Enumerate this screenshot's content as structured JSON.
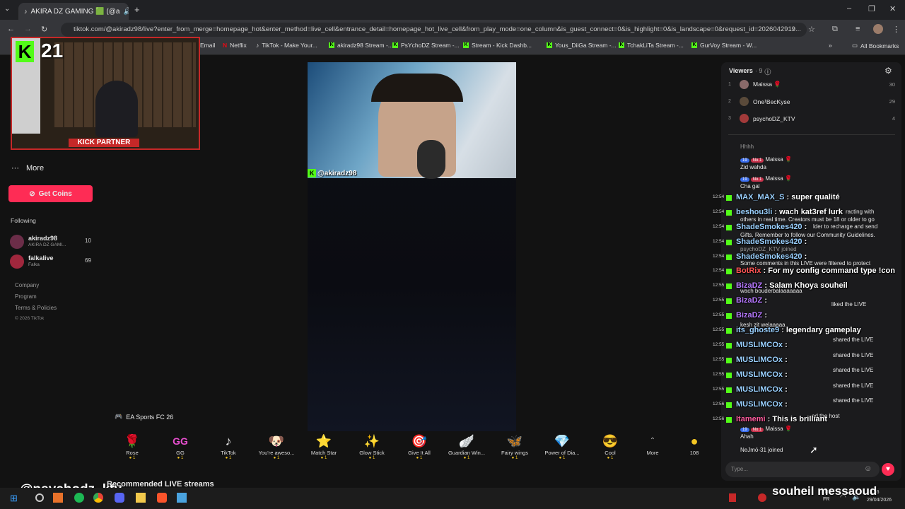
{
  "browser": {
    "tab_title": "AKIRA DZ GAMING 🟩 (@a",
    "url": "tiktok.com/@akiradz98/live?enter_from_merge=homepage_hot&enter_method=live_cell&entrance_detail=homepage_hot_live_cell&from_play_mode=one_column&is_guest_connect=0&is_highlight=0&is_landscape=0&request_id=2026042919...",
    "bookmarks": [
      "Email",
      "Netflix",
      "TikTok - Make Your...",
      "akiradz98 Stream -...",
      "PsYchoDZ Stream -...",
      "Stream - Kick Dashb...",
      "Yous_DiiGa Stream -...",
      "TchakLiTa Stream -...",
      "GurVoy Stream - W..."
    ],
    "all_bookmarks": "All Bookmarks"
  },
  "overlay": {
    "badge_number": "21",
    "kick_partner": "KICK PARTNER",
    "streamer_handle": "@akiradz98",
    "bottom_left_handle": "@psychodz_ktv",
    "bottom_right_name": "souheil messaoud"
  },
  "sidebar": {
    "more": "More",
    "get_coins": "Get Coins",
    "following_title": "Following",
    "following": [
      {
        "name": "akiradz98",
        "sub": "AKIRA DZ GAMI...",
        "count": "10"
      },
      {
        "name": "falkalive",
        "sub": "Falka",
        "count": "69"
      }
    ],
    "footer": [
      "Company",
      "Program",
      "Terms & Policies",
      "© 2026 TikTok"
    ]
  },
  "stream": {
    "game_tag": "EA Sports FC 26",
    "recommended": "Recommended LIVE streams"
  },
  "gifts": [
    {
      "label": "Rose",
      "price": "1",
      "icon": "🌹"
    },
    {
      "label": "GG",
      "price": "1",
      "icon": "GG"
    },
    {
      "label": "TikTok",
      "price": "1",
      "icon": "♪"
    },
    {
      "label": "You're aweso...",
      "price": "1",
      "icon": "🐶"
    },
    {
      "label": "Match Star",
      "price": "1",
      "icon": "⭐"
    },
    {
      "label": "Glow Stick",
      "price": "1",
      "icon": "✨"
    },
    {
      "label": "Give It All",
      "price": "1",
      "icon": "🎯"
    },
    {
      "label": "Guardian Win...",
      "price": "1",
      "icon": "🪽"
    },
    {
      "label": "Fairy wings",
      "price": "1",
      "icon": "🦋"
    },
    {
      "label": "Power of Dia...",
      "price": "1",
      "icon": "💎"
    },
    {
      "label": "Cool",
      "price": "1",
      "icon": "😎"
    }
  ],
  "gift_more": "More",
  "coin_balance": "108",
  "chat": {
    "viewers_label": "Viewers",
    "viewers_count": "· 9",
    "top_viewers": [
      {
        "rank": "1",
        "name": "Maissa 🌹",
        "score": "30"
      },
      {
        "rank": "2",
        "name": "One¹BecKyse",
        "score": "29"
      },
      {
        "rank": "3",
        "name": "psychoDZ_KTV",
        "score": "4"
      }
    ],
    "messages_small": [
      "Hhhh",
      "Maissa 🌹",
      "Zid wahda",
      "Maissa 🌹",
      "Cha gal",
      "others in real time. Creators must be 18 or older to go",
      "Gifts. Remember to follow our Community Guidelines.",
      "psychoDZ_KTV joined",
      "Some comments in this LIVE were filtered to protect",
      "wach bouderbalaaaaaaa",
      "liked the LIVE",
      "kesh zit welaaaaa",
      "shared the LIVE",
      "shared the LIVE",
      "shared the LIVE",
      "shared the LIVE",
      "shared the LIVE",
      "Maissa 🌹",
      "Ahah",
      "NeJmö-31 joined"
    ],
    "kick_messages": [
      {
        "time": "12:54",
        "user": "MAX_MAX_S",
        "text": ": super qualité"
      },
      {
        "time": "12:54",
        "user": "beshou3li",
        "text": ": wach kat3ref lurk"
      },
      {
        "time": "12:54",
        "user": "ShadeSmokes420",
        "text": ":"
      },
      {
        "time": "12:54",
        "user": "ShadeSmokes420",
        "text": ":"
      },
      {
        "time": "12:54",
        "user": "ShadeSmokes420",
        "text": ":"
      },
      {
        "time": "12:54",
        "user": "BotRix",
        "text": ": For my config command type !con"
      },
      {
        "time": "12:55",
        "user": "BizaDZ",
        "text": ": Salam Khoya souheil"
      },
      {
        "time": "12:55",
        "user": "BizaDZ",
        "text": ":"
      },
      {
        "time": "12:55",
        "user": "BizaDZ",
        "text": ":"
      },
      {
        "time": "12:55",
        "user": "its_ghoste9",
        "text": ": legendary gameplay"
      },
      {
        "time": "12:55",
        "user": "MUSLIMCOx",
        "text": ":"
      },
      {
        "time": "12:55",
        "user": "MUSLIMCOx",
        "text": ":"
      },
      {
        "time": "12:55",
        "user": "MUSLIMCOx",
        "text": ":"
      },
      {
        "time": "12:55",
        "user": "MUSLIMCOx",
        "text": ":"
      },
      {
        "time": "12:56",
        "user": "MUSLIMCOx",
        "text": ":"
      },
      {
        "time": "12:56",
        "user": "Itamemi",
        "text": ": This is brilliant"
      }
    ],
    "input_placeholder": "Type...",
    "extra": [
      "racting with",
      "lder to recharge and send",
      "ed the host"
    ]
  },
  "taskbar": {
    "lang": "ENG",
    "region": "FR",
    "time": "12:56",
    "date": "29/04/2026"
  },
  "colors": {
    "kick_green": "#53fc18",
    "get_coins_red": "#fe2c55",
    "partner_red": "#c62828"
  }
}
